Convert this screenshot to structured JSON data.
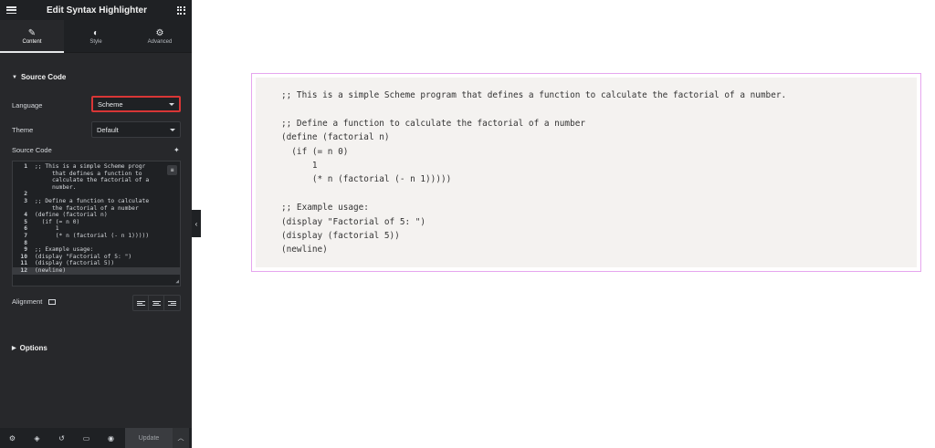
{
  "topbar": {
    "title": "Edit Syntax Highlighter"
  },
  "tabs": [
    {
      "label": "Content",
      "icon": "pencil-icon",
      "glyph": "✎"
    },
    {
      "label": "Style",
      "icon": "half-circle-icon",
      "glyph": "◐"
    },
    {
      "label": "Advanced",
      "icon": "gear-icon",
      "glyph": "⚙"
    }
  ],
  "source_code_section": {
    "heading": "Source Code",
    "language_label": "Language",
    "language_value": "Scheme",
    "theme_label": "Theme",
    "theme_value": "Default",
    "source_code_label": "Source Code"
  },
  "editor": {
    "lines": [
      {
        "num": "1",
        "text": ";; This is a simple Scheme progr"
      },
      {
        "num": "",
        "text": "     that defines a function to"
      },
      {
        "num": "",
        "text": "     calculate the factorial of a"
      },
      {
        "num": "",
        "text": "     number."
      },
      {
        "num": "2",
        "text": ""
      },
      {
        "num": "3",
        "text": ";; Define a function to calculate"
      },
      {
        "num": "",
        "text": "     the factorial of a number"
      },
      {
        "num": "4",
        "text": "(define (factorial n)"
      },
      {
        "num": "5",
        "text": "  (if (= n 0)"
      },
      {
        "num": "6",
        "text": "      1"
      },
      {
        "num": "7",
        "text": "      (* n (factorial (- n 1)))))"
      },
      {
        "num": "8",
        "text": ""
      },
      {
        "num": "9",
        "text": ";; Example usage:"
      },
      {
        "num": "10",
        "text": "(display \"Factorial of 5: \")"
      },
      {
        "num": "11",
        "text": "(display (factorial 5))"
      },
      {
        "num": "12",
        "text": "(newline)"
      }
    ]
  },
  "alignment": {
    "label": "Alignment"
  },
  "options_section": {
    "heading": "Options"
  },
  "bottombar": {
    "update_label": "Update"
  },
  "preview": {
    "code_lines": [
      ";; This is a simple Scheme program that defines a function to calculate the factorial of a number.",
      "",
      ";; Define a function to calculate the factorial of a number",
      "(define (factorial n)",
      "  (if (= n 0)",
      "      1",
      "      (* n (factorial (- n 1)))))",
      "",
      ";; Example usage:",
      "(display \"Factorial of 5: \")",
      "(display (factorial 5))",
      "(newline)"
    ]
  },
  "colors": {
    "panel": "#27282b",
    "panel_dark": "#1f2124",
    "highlight_border": "#d93636",
    "preview_border": "#e6a6ee",
    "code_bg": "#f4f2f0"
  }
}
